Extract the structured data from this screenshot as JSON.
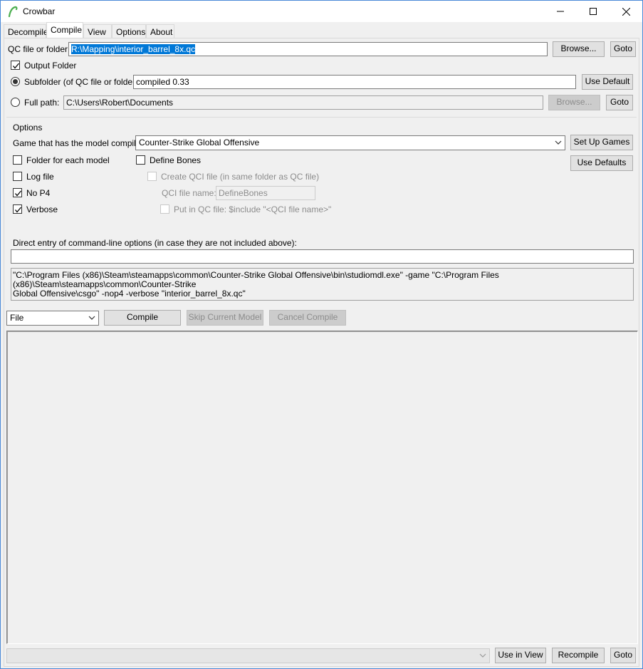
{
  "window": {
    "title": "Crowbar"
  },
  "tabs": [
    "Decompile",
    "Compile",
    "View",
    "Options",
    "About"
  ],
  "active_tab": "Compile",
  "qc": {
    "label": "QC file or folder:",
    "value": "R:\\Mapping\\interior_barrel_8x.qc",
    "browse_label": "Browse...",
    "goto_label": "Goto"
  },
  "output": {
    "checkbox_label": "Output Folder",
    "checked": true,
    "subfolder_label": "Subfolder (of QC file or folder):",
    "subfolder_value": "compiled 0.33",
    "use_default_label": "Use Default",
    "fullpath_label": "Full path:",
    "fullpath_value": "C:\\Users\\Robert\\Documents",
    "browse_label": "Browse...",
    "goto_label": "Goto"
  },
  "options": {
    "group_label": "Options",
    "game_label": "Game that has the model compiler:",
    "game_value": "Counter-Strike Global Offensive",
    "setup_games_label": "Set Up Games",
    "use_defaults_label": "Use Defaults",
    "folder_each_model": "Folder for each model",
    "define_bones": "Define Bones",
    "log_file": "Log file",
    "create_qci": "Create QCI file (in same folder as QC file)",
    "no_p4": "No P4",
    "qci_name_label": "QCI file name:",
    "qci_name_value": "DefineBones",
    "verbose": "Verbose",
    "put_in_qc": "Put in QC file: $include \"<QCI file name>\""
  },
  "direct_entry": {
    "label": "Direct entry of command-line options (in case they are not included above):",
    "value": ""
  },
  "command_line": {
    "line1": "\"C:\\Program Files (x86)\\Steam\\steamapps\\common\\Counter-Strike Global Offensive\\bin\\studiomdl.exe\" -game \"C:\\Program Files (x86)\\Steam\\steamapps\\common\\Counter-Strike",
    "line2": "Global Offensive\\csgo\" -nop4 -verbose \"interior_barrel_8x.qc\""
  },
  "actions": {
    "mode_value": "File",
    "compile_label": "Compile",
    "skip_label": "Skip Current Model",
    "cancel_label": "Cancel Compile"
  },
  "bottom": {
    "use_in_view_label": "Use in View",
    "recompile_label": "Recompile",
    "goto_label": "Goto"
  }
}
